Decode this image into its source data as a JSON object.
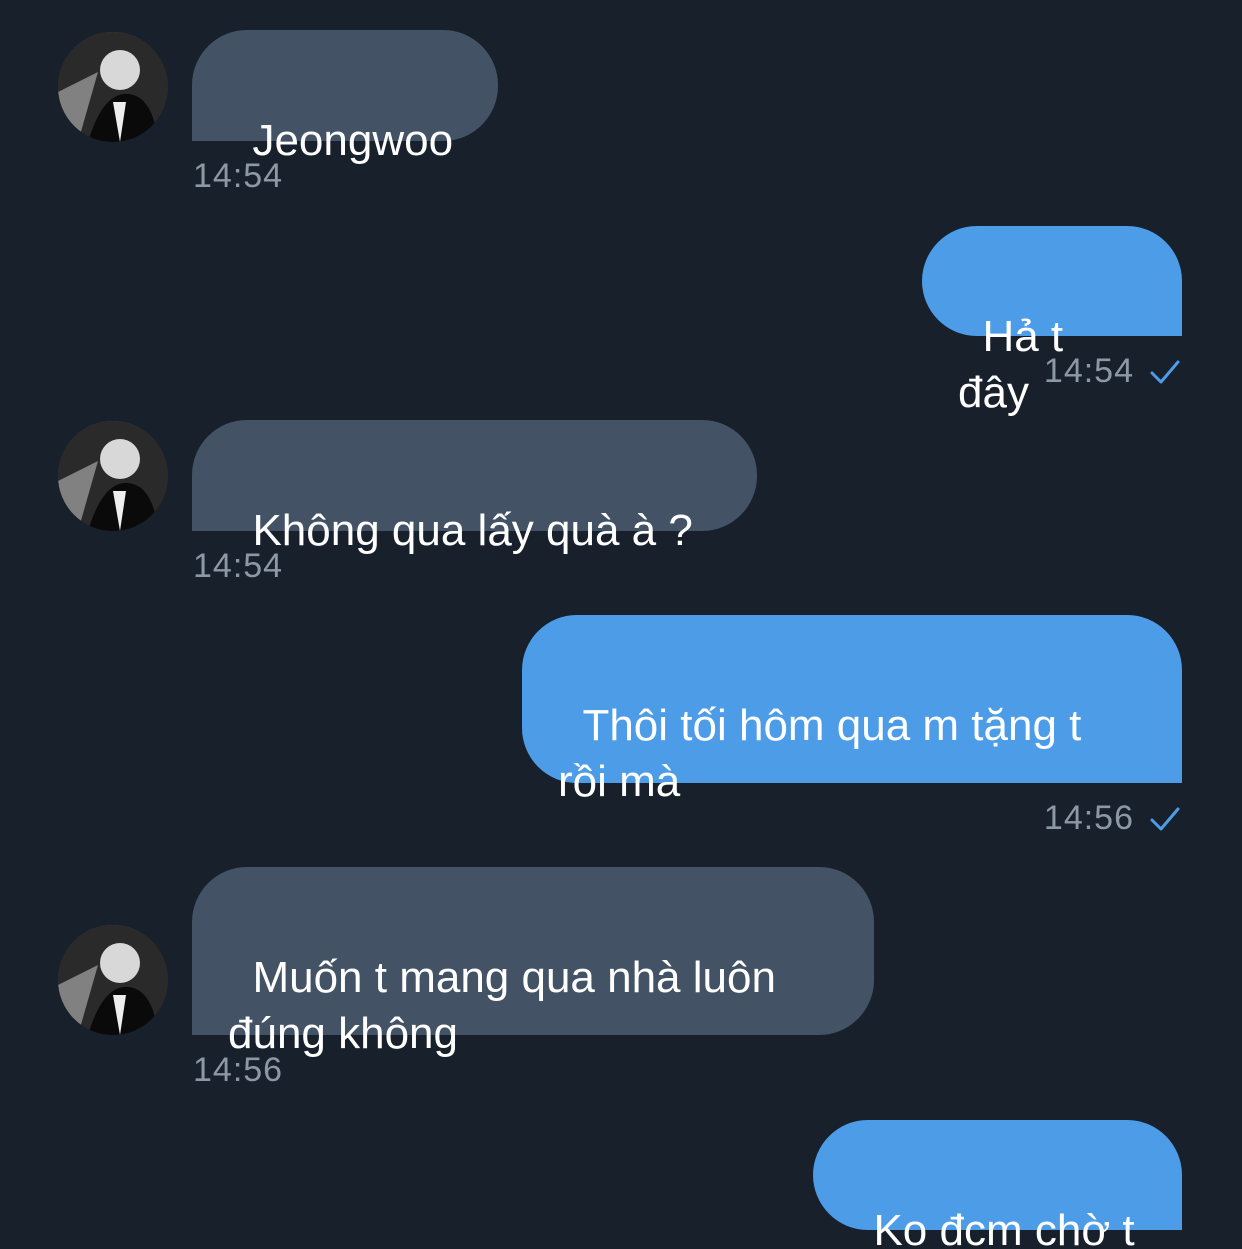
{
  "messages": [
    {
      "direction": "incoming",
      "text": "Jeongwoo",
      "time": "14:54"
    },
    {
      "direction": "outgoing",
      "text": "Hả t đây",
      "time": "14:54",
      "status_icon": "check-icon"
    },
    {
      "direction": "incoming",
      "text": "Không qua lấy quà à ?",
      "time": "14:54"
    },
    {
      "direction": "outgoing",
      "text": "Thôi tối hôm qua m tặng t\nrồi mà",
      "time": "14:56",
      "status_icon": "check-icon"
    },
    {
      "direction": "incoming",
      "text": "Muốn t mang qua nhà luôn\nđúng không",
      "time": "14:56"
    },
    {
      "direction": "outgoing",
      "text": "Ko đcm chờ t"
    }
  ],
  "colors": {
    "background": "#18202b",
    "incoming_bubble": "#435365",
    "outgoing_bubble": "#4c9ce8",
    "timestamp": "#8d98a5",
    "check": "#4c9ce8"
  }
}
